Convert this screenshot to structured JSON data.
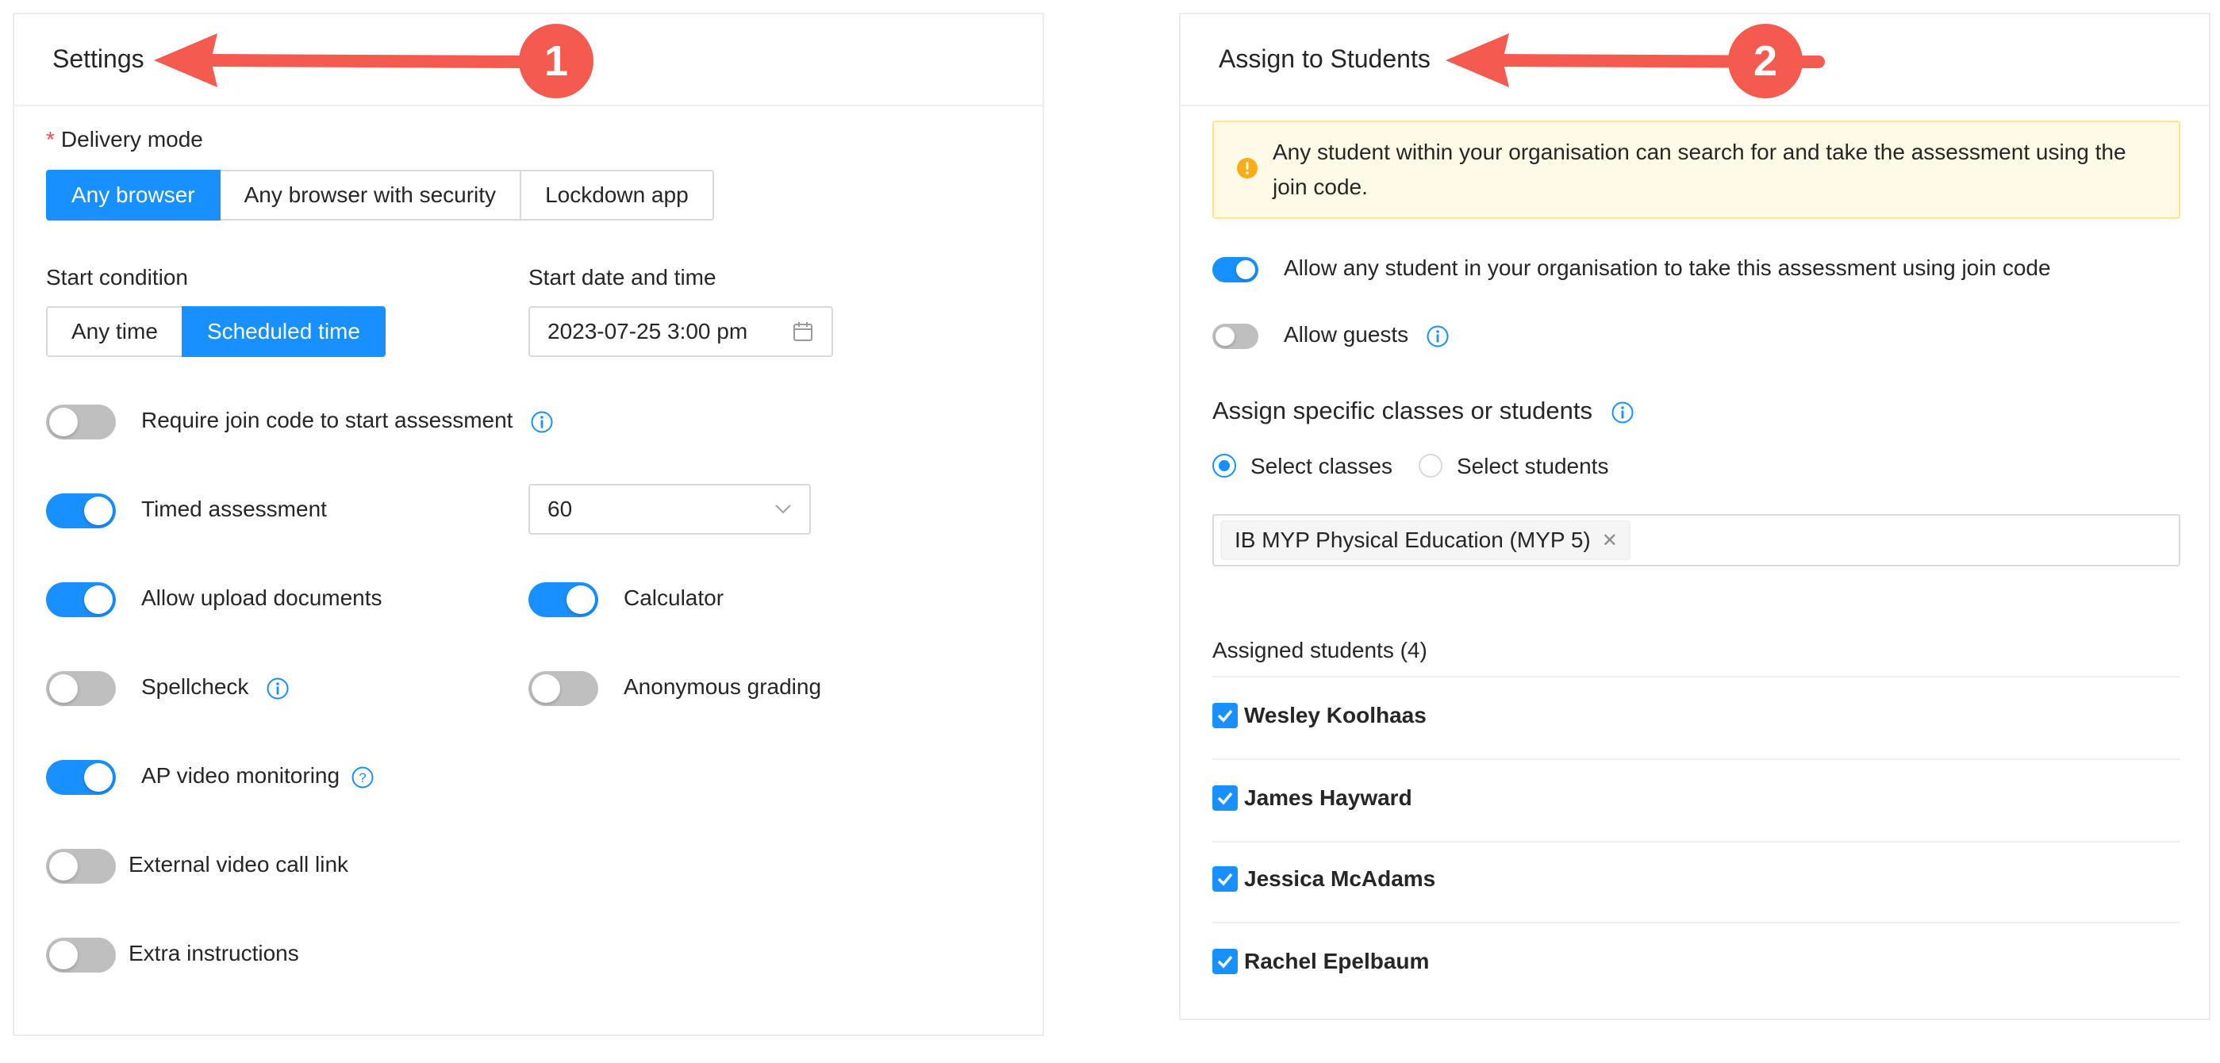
{
  "settings": {
    "title": "Settings",
    "callout_number": "1",
    "delivery_mode": {
      "label": "Delivery mode",
      "options": [
        "Any browser",
        "Any browser with security",
        "Lockdown app"
      ],
      "selected": "Any browser"
    },
    "start_condition": {
      "label": "Start condition",
      "options": [
        "Any time",
        "Scheduled time"
      ],
      "selected": "Scheduled time"
    },
    "start_datetime": {
      "label": "Start date and time",
      "value": "2023-07-25 3:00 pm"
    },
    "toggles": {
      "require_join_code": {
        "label": "Require join code to start assessment",
        "on": false
      },
      "timed_assessment": {
        "label": "Timed assessment",
        "on": true
      },
      "timed_minutes": "60",
      "allow_upload": {
        "label": "Allow upload documents",
        "on": true
      },
      "calculator": {
        "label": "Calculator",
        "on": true
      },
      "spellcheck": {
        "label": "Spellcheck",
        "on": false
      },
      "anonymous_grading": {
        "label": "Anonymous grading",
        "on": false
      },
      "ap_video_monitoring": {
        "label": "AP video monitoring",
        "on": true
      },
      "external_video_call": {
        "label": "External video call link",
        "on": false
      },
      "extra_instructions": {
        "label": "Extra instructions",
        "on": false
      }
    }
  },
  "assign": {
    "title": "Assign to Students",
    "callout_number": "2",
    "alert_text": "Any student within your organisation can search for and take the assessment using the join code.",
    "allow_join_code": {
      "label": "Allow any student in your organisation to take this assessment using join code",
      "on": true
    },
    "allow_guests": {
      "label": "Allow guests",
      "on": false
    },
    "specific_heading": "Assign specific classes or students",
    "radio_options": [
      "Select classes",
      "Select students"
    ],
    "radio_selected": "Select classes",
    "selected_classes": [
      "IB MYP Physical Education (MYP 5)"
    ],
    "assigned_heading": "Assigned students (4)",
    "students": [
      {
        "name": "Wesley Koolhaas",
        "checked": true
      },
      {
        "name": "James Hayward",
        "checked": true
      },
      {
        "name": "Jessica McAdams",
        "checked": true
      },
      {
        "name": "Rachel Epelbaum",
        "checked": true
      }
    ]
  },
  "colors": {
    "primary": "#1890ff",
    "callout": "#f45b4e",
    "warning": "#faad14",
    "switch_off": "#bfbfbf"
  },
  "icons": {
    "info": "info-icon",
    "help": "help-icon",
    "calendar": "calendar-icon",
    "chevron": "chevron-down-icon",
    "warning": "warning-icon",
    "close": "close-icon",
    "check": "check-icon"
  }
}
